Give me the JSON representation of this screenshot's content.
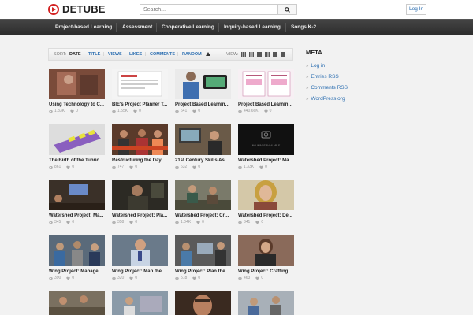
{
  "header": {
    "logo_text": "DETUBE",
    "search_placeholder": "Search...",
    "login_label": "Log In"
  },
  "nav": {
    "items": [
      {
        "label": "Project-based Learning"
      },
      {
        "label": "Assessment"
      },
      {
        "label": "Cooperative Learning"
      },
      {
        "label": "Inquiry-based Learning"
      },
      {
        "label": "Songs K-2"
      }
    ]
  },
  "sortbar": {
    "sort_label": "SORT:",
    "options": [
      "DATE",
      "TITLE",
      "VIEWS",
      "LIKES",
      "COMMENTS",
      "RANDOM"
    ],
    "active": "DATE",
    "view_label": "VIEW:"
  },
  "videos": [
    {
      "title": "Using Technology to C...",
      "views": "1.33K",
      "likes": "0"
    },
    {
      "title": "BIE's Project Planner T...",
      "views": "1.55K",
      "likes": "0"
    },
    {
      "title": "Project Based Learning...",
      "views": "641",
      "likes": "0"
    },
    {
      "title": "Project Based Learning...",
      "views": "440.66K",
      "likes": "0"
    },
    {
      "title": "The Birth of the Tubric",
      "views": "861",
      "likes": "0"
    },
    {
      "title": "Restructuring the Day",
      "views": "747",
      "likes": "0"
    },
    {
      "title": "21st Century Skills Ass...",
      "views": "632",
      "likes": "0"
    },
    {
      "title": "Watershed Project: Ma...",
      "views": "1.33K",
      "likes": "0",
      "no_image_text": "NO IMAGE AVAILABLE"
    },
    {
      "title": "Watershed Project: Ma...",
      "views": "345",
      "likes": "0"
    },
    {
      "title": "Watershed Project: Pla...",
      "views": "358",
      "likes": "0"
    },
    {
      "title": "Watershed Project: Cra...",
      "views": "1.04K",
      "likes": "0"
    },
    {
      "title": "Watershed Project: De...",
      "views": "341",
      "likes": "0"
    },
    {
      "title": "Wing Project: Manage t...",
      "views": "390",
      "likes": "0"
    },
    {
      "title": "Wing Project: Map the P...",
      "views": "320",
      "likes": "0"
    },
    {
      "title": "Wing Project: Plan the ...",
      "views": "518",
      "likes": "0"
    },
    {
      "title": "Wing Project: Crafting ...",
      "views": "463",
      "likes": "0"
    },
    {
      "title": "",
      "views": "",
      "likes": ""
    },
    {
      "title": "",
      "views": "",
      "likes": ""
    },
    {
      "title": "",
      "views": "",
      "likes": ""
    },
    {
      "title": "",
      "views": "",
      "likes": ""
    }
  ],
  "sidebar": {
    "title": "META",
    "links": [
      "Log in",
      "Entries RSS",
      "Comments RSS",
      "WordPress.org"
    ]
  },
  "colors": {
    "accent_red": "#d32323",
    "link_blue": "#2a6db0",
    "nav_bg": "#333333"
  }
}
